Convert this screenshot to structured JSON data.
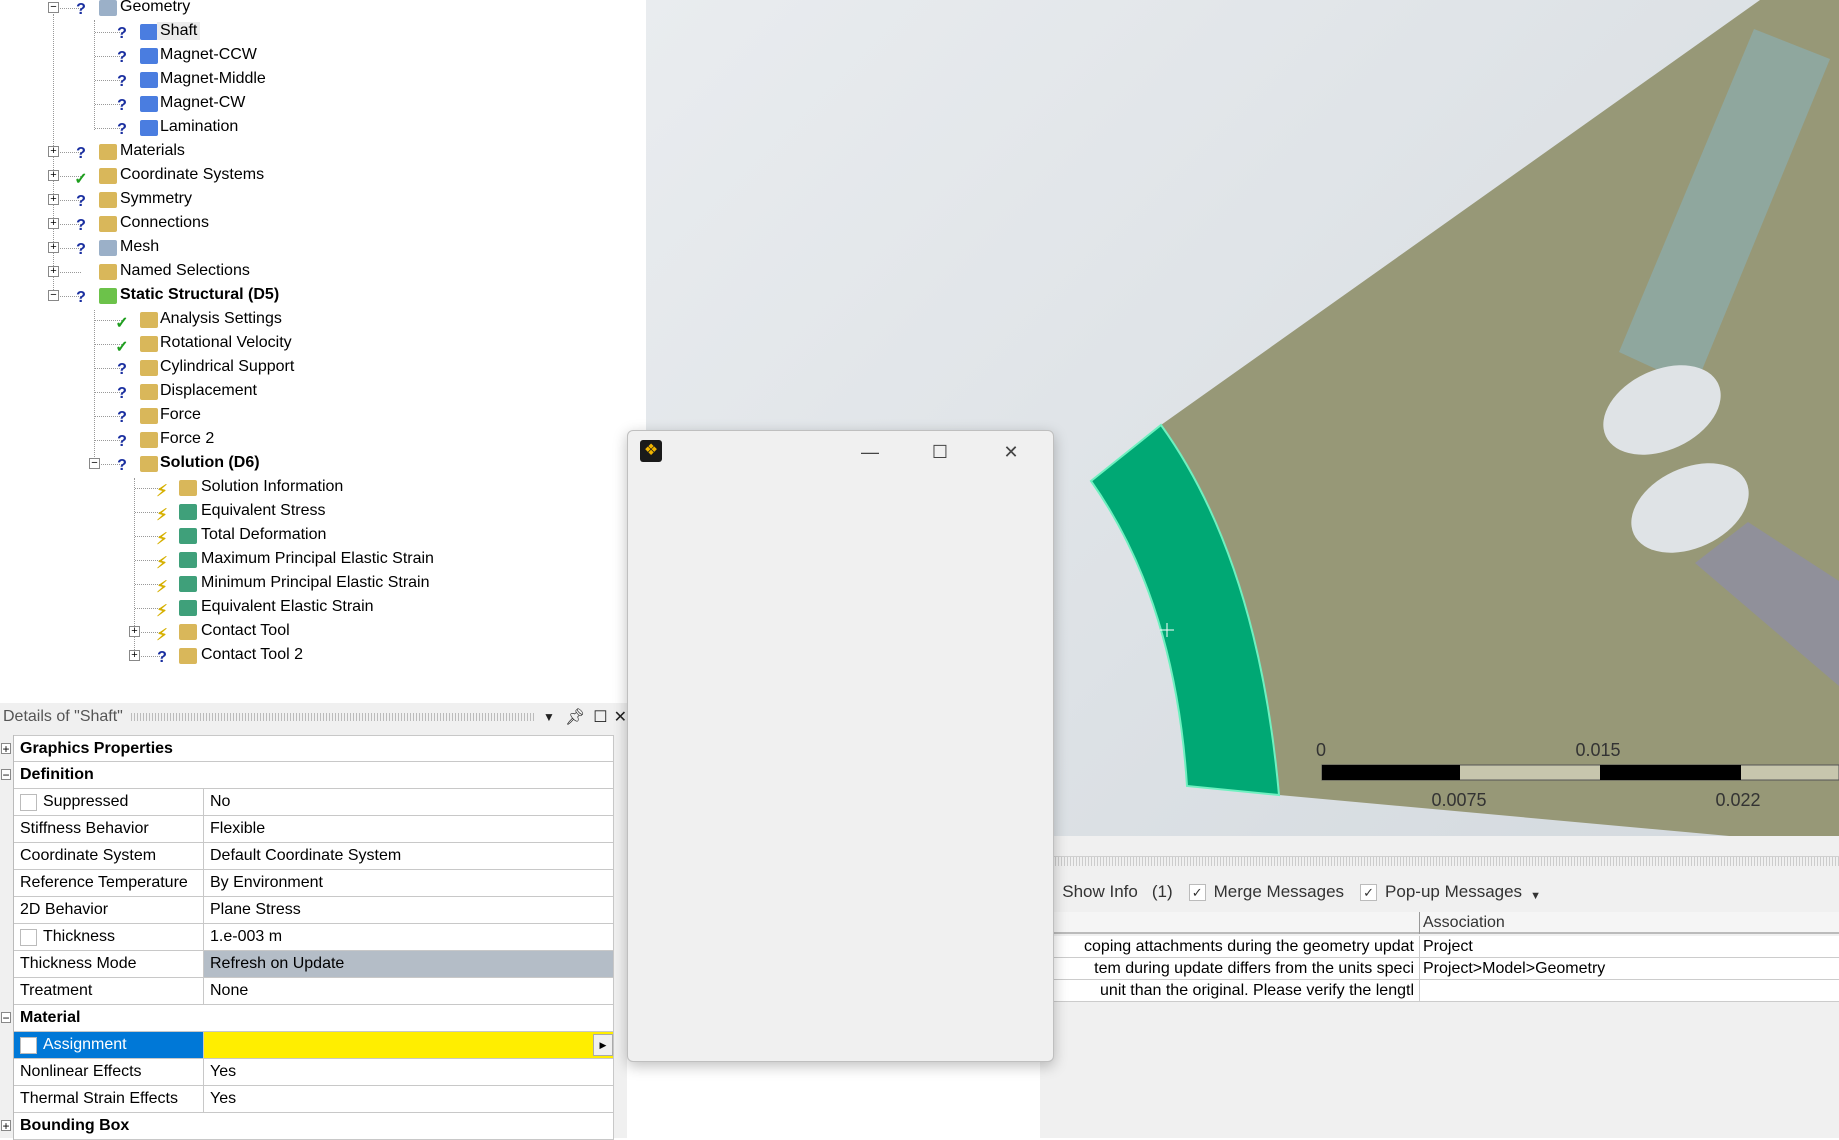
{
  "tree": {
    "items": [
      {
        "label": "Geometry",
        "depth": 0,
        "status": "question",
        "icon": "geometry-icon",
        "expander": "minus"
      },
      {
        "label": "Shaft",
        "depth": 1,
        "status": "question",
        "icon": "body-icon",
        "selected": true
      },
      {
        "label": "Magnet-CCW",
        "depth": 1,
        "status": "question",
        "icon": "body-icon"
      },
      {
        "label": "Magnet-Middle",
        "depth": 1,
        "status": "question",
        "icon": "body-icon"
      },
      {
        "label": "Magnet-CW",
        "depth": 1,
        "status": "question",
        "icon": "body-icon"
      },
      {
        "label": "Lamination",
        "depth": 1,
        "status": "question",
        "icon": "body-icon"
      },
      {
        "label": "Materials",
        "depth": 0,
        "status": "question",
        "icon": "materials-icon",
        "expander": "plus"
      },
      {
        "label": "Coordinate Systems",
        "depth": 0,
        "status": "check",
        "icon": "coordinate-systems-icon",
        "expander": "plus"
      },
      {
        "label": "Symmetry",
        "depth": 0,
        "status": "question",
        "icon": "symmetry-icon",
        "expander": "plus"
      },
      {
        "label": "Connections",
        "depth": 0,
        "status": "question",
        "icon": "connections-icon",
        "expander": "plus"
      },
      {
        "label": "Mesh",
        "depth": 0,
        "status": "question",
        "icon": "mesh-icon",
        "expander": "plus"
      },
      {
        "label": "Named Selections",
        "depth": 0,
        "status": "none",
        "icon": "named-selections-icon",
        "expander": "plus"
      },
      {
        "label": "Static Structural (D5)",
        "depth": 0,
        "status": "question",
        "icon": "static-structural-icon",
        "expander": "minus",
        "bold": true
      },
      {
        "label": "Analysis Settings",
        "depth": 1,
        "status": "check",
        "icon": "analysis-settings-icon"
      },
      {
        "label": "Rotational Velocity",
        "depth": 1,
        "status": "check",
        "icon": "rotational-velocity-icon"
      },
      {
        "label": "Cylindrical Support",
        "depth": 1,
        "status": "question",
        "icon": "cylindrical-support-icon"
      },
      {
        "label": "Displacement",
        "depth": 1,
        "status": "question",
        "icon": "displacement-icon"
      },
      {
        "label": "Force",
        "depth": 1,
        "status": "question",
        "icon": "force-icon"
      },
      {
        "label": "Force 2",
        "depth": 1,
        "status": "question",
        "icon": "force-icon"
      },
      {
        "label": "Solution (D6)",
        "depth": 1,
        "status": "question",
        "icon": "solution-icon",
        "expander": "minus",
        "bold": true
      },
      {
        "label": "Solution Information",
        "depth": 2,
        "status": "lightning",
        "icon": "solution-information-icon"
      },
      {
        "label": "Equivalent Stress",
        "depth": 2,
        "status": "lightning",
        "icon": "result-icon"
      },
      {
        "label": "Total Deformation",
        "depth": 2,
        "status": "lightning",
        "icon": "result-icon"
      },
      {
        "label": "Maximum Principal Elastic Strain",
        "depth": 2,
        "status": "lightning",
        "icon": "result-icon"
      },
      {
        "label": "Minimum Principal Elastic Strain",
        "depth": 2,
        "status": "lightning",
        "icon": "result-icon"
      },
      {
        "label": "Equivalent Elastic Strain",
        "depth": 2,
        "status": "lightning",
        "icon": "result-icon"
      },
      {
        "label": "Contact Tool",
        "depth": 2,
        "status": "lightning",
        "icon": "contact-tool-icon",
        "expander": "plus"
      },
      {
        "label": "Contact Tool 2",
        "depth": 2,
        "status": "question",
        "icon": "contact-tool-icon",
        "expander": "plus"
      }
    ]
  },
  "details": {
    "title": "Details of \"Shaft\"",
    "rows": [
      {
        "type": "section",
        "label": "Graphics Properties",
        "sign": "+"
      },
      {
        "type": "section",
        "label": "Definition",
        "sign": "-"
      },
      {
        "label": "Suppressed",
        "value": "No",
        "checkbox": true
      },
      {
        "label": "Stiffness Behavior",
        "value": "Flexible"
      },
      {
        "label": "Coordinate System",
        "value": "Default Coordinate System"
      },
      {
        "label": "Reference Temperature",
        "value": "By Environment"
      },
      {
        "label": "2D Behavior",
        "value": "Plane Stress"
      },
      {
        "label": "Thickness",
        "value": "1.e-003 m",
        "checkbox": true
      },
      {
        "label": "Thickness Mode",
        "value": "Refresh on Update",
        "readonly": true
      },
      {
        "label": "Treatment",
        "value": "None"
      },
      {
        "type": "section",
        "label": "Material",
        "sign": "-"
      },
      {
        "label": "Assignment",
        "value": "",
        "checkbox": true,
        "selected": true,
        "missing": true
      },
      {
        "label": "Nonlinear Effects",
        "value": "Yes"
      },
      {
        "label": "Thermal Strain Effects",
        "value": "Yes"
      },
      {
        "type": "section",
        "label": "Bounding Box",
        "sign": "+"
      }
    ]
  },
  "viewport": {
    "scale": {
      "top": [
        "0",
        "0.015"
      ],
      "bottom": [
        "0.0075",
        "0.022"
      ]
    },
    "colors": {
      "shaft": "#00a874",
      "lamination": "#979877",
      "magnet1": "#8fa79e",
      "magnet2": "#90909a"
    }
  },
  "messages": {
    "show_info": "Show Info",
    "info_count": "(1)",
    "merge": "Merge Messages",
    "popup": "Pop-up Messages",
    "col_association": "Association",
    "rows": [
      {
        "text": "coping attachments during the geometry updat",
        "association": "Project"
      },
      {
        "text": "tem during update differs from the units speci",
        "association": "Project>Model>Geometry"
      },
      {
        "text": "unit than the original.  Please verify the lengtl",
        "association": ""
      }
    ]
  },
  "dialog": {
    "minimize": "—",
    "maximize": "☐",
    "close": "✕"
  }
}
